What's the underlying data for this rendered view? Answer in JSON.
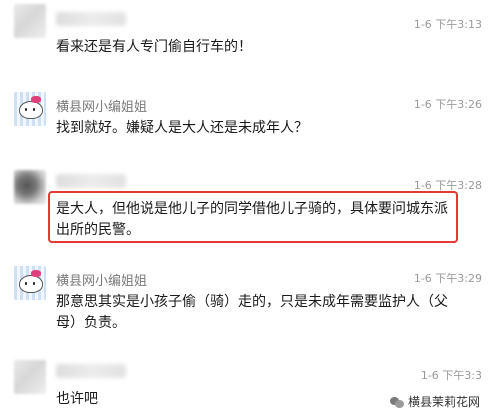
{
  "messages": [
    {
      "name": "",
      "time": "1-6 下午3:13",
      "text": "看来还是有人专门偷自行车的！"
    },
    {
      "name": "横县网小编姐姐",
      "time": "1-6 下午3:26",
      "text": "找到就好。嫌疑人是大人还是未成年人？"
    },
    {
      "name": "",
      "time": "1-6 下午3:28",
      "text_line1": "是大人，但他说是他儿子的同学借他儿子骑的，具体要问城东派",
      "text_line2": "出所的民警。"
    },
    {
      "name": "横县网小编姐姐",
      "time": "1-6 下午3:29",
      "text_line1": "那意思其实是小孩子偷（骑）走的，只是未成年需要监护人（父",
      "text_line2": "母）负责。"
    },
    {
      "name": "",
      "time": "1-6 下午3:3",
      "text": "也许吧"
    }
  ],
  "watermark": "横县茉莉花网",
  "icons": {
    "watermark": "wechat-icon"
  }
}
